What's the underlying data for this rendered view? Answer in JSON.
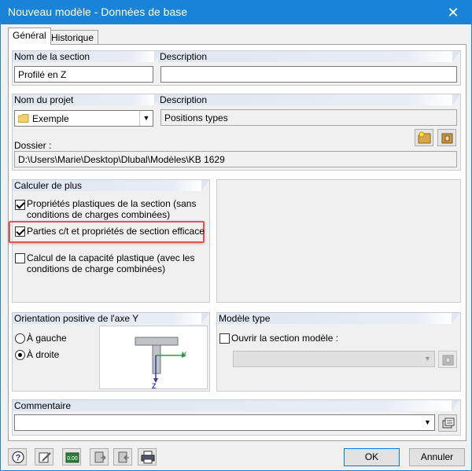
{
  "window": {
    "title": "Nouveau modèle - Données de base",
    "close_glyph": "✕"
  },
  "tabs": [
    {
      "label": "Général",
      "active": true
    },
    {
      "label": "Historique",
      "active": false
    }
  ],
  "section": {
    "name_label": "Nom de la section",
    "name_value": "Profilé en Z",
    "description_label": "Description",
    "description_value": ""
  },
  "project": {
    "name_label": "Nom du projet",
    "name_value": "Exemple",
    "description_label": "Description",
    "description_value": "Positions types",
    "folder_label": "Dossier :",
    "folder_value": "D:\\Users\\Marie\\Desktop\\Dlubal\\Modèles\\KB 1629"
  },
  "calculate": {
    "header": "Calculer de plus",
    "options": [
      {
        "label_line1": "Propriétés plastiques de la section (sans",
        "label_line2": "conditions de charges combinées)",
        "checked": true
      },
      {
        "label_line1": "Parties c/t et propriétés de section efficace",
        "label_line2": "",
        "checked": true,
        "highlighted": true
      },
      {
        "label_line1": "Calcul de la capacité plastique (avec les",
        "label_line2": "conditions de charge combinées)",
        "checked": false
      }
    ]
  },
  "orientation": {
    "header": "Orientation positive de l'axe Y",
    "options": [
      {
        "label": "À gauche",
        "checked": false
      },
      {
        "label": "À droite",
        "checked": true
      }
    ],
    "axis_y": "Y",
    "axis_z": "Z"
  },
  "template": {
    "header": "Modèle type",
    "open_label": "Ouvrir la section modèle :",
    "open_checked": false,
    "combo_value": ""
  },
  "comment": {
    "header": "Commentaire",
    "value": ""
  },
  "buttons": {
    "ok": "OK",
    "cancel": "Annuler"
  },
  "colors": {
    "titlebar": "#1883d7",
    "group_header": "#dfe6f1",
    "highlight": "#e05454"
  }
}
